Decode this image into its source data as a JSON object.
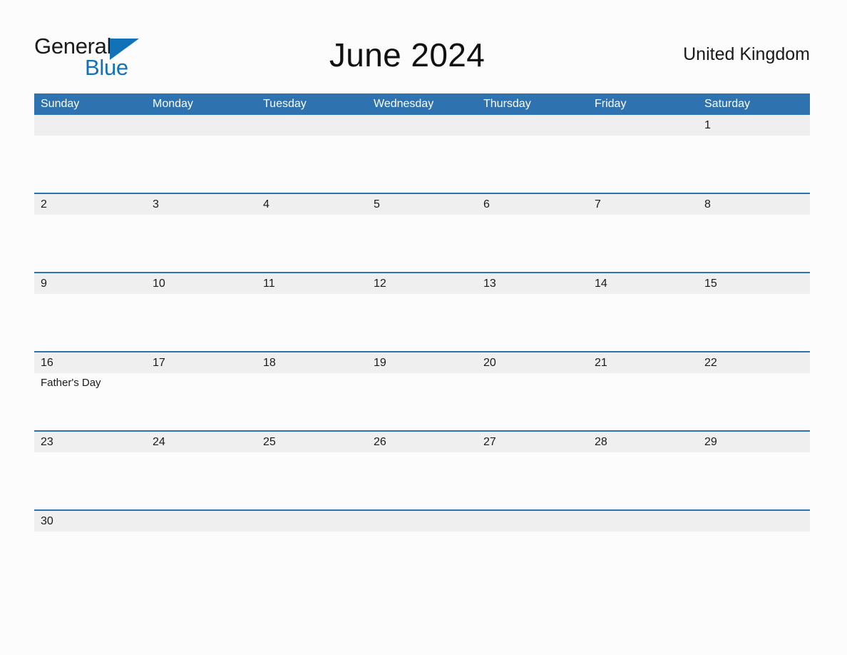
{
  "brand": {
    "name_top": "General",
    "name_bottom": "Blue",
    "triangle_color": "#1272b8",
    "top_text_color": "#1a1a1a"
  },
  "header": {
    "title": "June 2024",
    "country": "United Kingdom"
  },
  "colors": {
    "header_blue": "#2e72b0",
    "row_divider_blue": "#2e72b0",
    "date_band_gray": "#efefef",
    "page_background": "#fcfcfc",
    "text": "#1a1a1a"
  },
  "calendar": {
    "weekdays": [
      "Sunday",
      "Monday",
      "Tuesday",
      "Wednesday",
      "Thursday",
      "Friday",
      "Saturday"
    ],
    "weeks": [
      {
        "days": [
          {
            "date": "",
            "events": []
          },
          {
            "date": "",
            "events": []
          },
          {
            "date": "",
            "events": []
          },
          {
            "date": "",
            "events": []
          },
          {
            "date": "",
            "events": []
          },
          {
            "date": "",
            "events": []
          },
          {
            "date": "1",
            "events": []
          }
        ]
      },
      {
        "days": [
          {
            "date": "2",
            "events": []
          },
          {
            "date": "3",
            "events": []
          },
          {
            "date": "4",
            "events": []
          },
          {
            "date": "5",
            "events": []
          },
          {
            "date": "6",
            "events": []
          },
          {
            "date": "7",
            "events": []
          },
          {
            "date": "8",
            "events": []
          }
        ]
      },
      {
        "days": [
          {
            "date": "9",
            "events": []
          },
          {
            "date": "10",
            "events": []
          },
          {
            "date": "11",
            "events": []
          },
          {
            "date": "12",
            "events": []
          },
          {
            "date": "13",
            "events": []
          },
          {
            "date": "14",
            "events": []
          },
          {
            "date": "15",
            "events": []
          }
        ]
      },
      {
        "days": [
          {
            "date": "16",
            "events": [
              "Father's Day"
            ]
          },
          {
            "date": "17",
            "events": []
          },
          {
            "date": "18",
            "events": []
          },
          {
            "date": "19",
            "events": []
          },
          {
            "date": "20",
            "events": []
          },
          {
            "date": "21",
            "events": []
          },
          {
            "date": "22",
            "events": []
          }
        ]
      },
      {
        "days": [
          {
            "date": "23",
            "events": []
          },
          {
            "date": "24",
            "events": []
          },
          {
            "date": "25",
            "events": []
          },
          {
            "date": "26",
            "events": []
          },
          {
            "date": "27",
            "events": []
          },
          {
            "date": "28",
            "events": []
          },
          {
            "date": "29",
            "events": []
          }
        ]
      },
      {
        "days": [
          {
            "date": "30",
            "events": []
          },
          {
            "date": "",
            "events": []
          },
          {
            "date": "",
            "events": []
          },
          {
            "date": "",
            "events": []
          },
          {
            "date": "",
            "events": []
          },
          {
            "date": "",
            "events": []
          },
          {
            "date": "",
            "events": []
          }
        ]
      }
    ]
  }
}
